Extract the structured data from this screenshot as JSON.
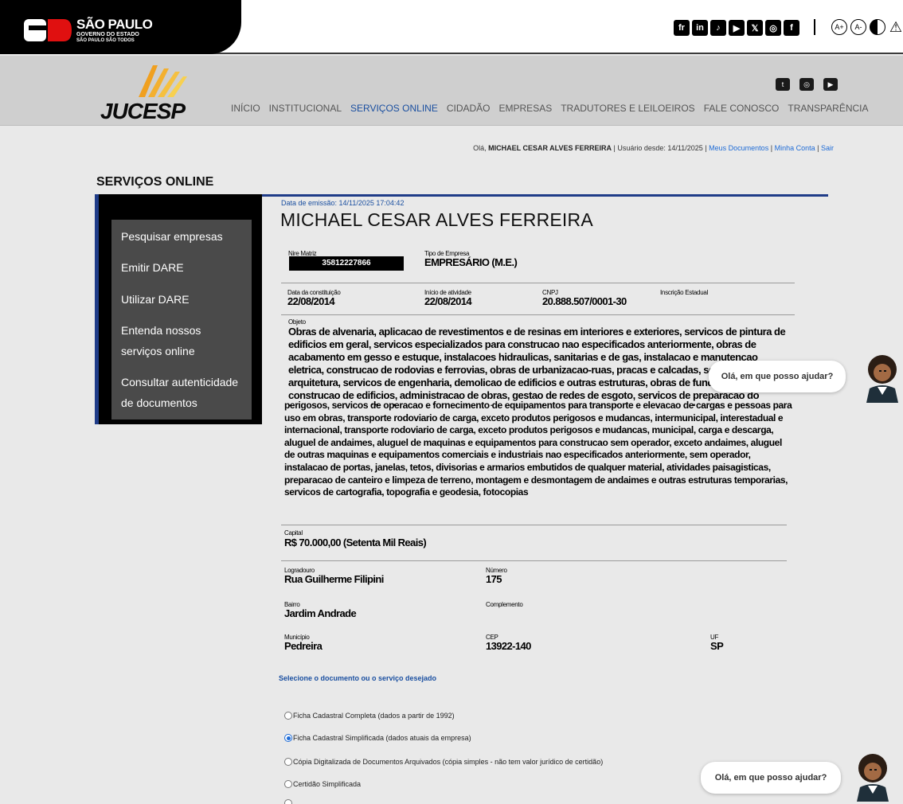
{
  "gov": {
    "title": "SÃO PAULO",
    "subtitle": "GOVERNO DO ESTADO",
    "slogan": "SÃO PAULO SÃO TODOS",
    "social": [
      "fr",
      "in",
      "♪",
      "▶",
      "𝕏",
      "◎",
      "f"
    ],
    "accessibility": [
      "A+",
      "A-"
    ]
  },
  "jucesp": {
    "logo_text": "JUCESP",
    "nav": [
      "INÍCIO",
      "INSTITUCIONAL",
      "SERVIÇOS ONLINE",
      "CIDADÃO",
      "EMPRESAS",
      "TRADUTORES E LEILOEIROS",
      "FALE CONOSCO",
      "TRANSPARÊNCIA"
    ]
  },
  "user": {
    "greeting": "Olá,",
    "name": "MICHAEL CESAR ALVES FERREIRA",
    "since": "| Usuário desde: 14/11/2025 |",
    "my_docs": "Meus Documentos",
    "sep": "|",
    "my_account": "Minha Conta",
    "sep2": "|",
    "logout": "Sair"
  },
  "section_title": "SERVIÇOS ONLINE",
  "menu": [
    "Pesquisar empresas",
    "Emitir DARE",
    "Utilizar DARE",
    "Entenda nossos serviços online",
    "Consultar autenticidade de documentos"
  ],
  "record": {
    "emission": "Data de emissão: 14/11/2025 17:04:42",
    "company_name": "MICHAEL CESAR ALVES FERREIRA",
    "nire_label": "Nire Matriz",
    "nire": "35812227866",
    "tipo_label": "Tipo de Empresa",
    "tipo": "EMPRESÁRIO (M.E.)",
    "constituicao_label": "Data da constituição",
    "constituicao": "22/08/2014",
    "inicio_label": "Início de atividade",
    "inicio": "22/08/2014",
    "cnpj_label": "CNPJ",
    "cnpj": "20.888.507/0001-30",
    "ie_label": "Inscrição Estadual",
    "objeto_label": "Objeto",
    "objeto_part1": "Obras de alvenaria, aplicacao de revestimentos e de resinas em interiores e exteriores, servicos de pintura de edificios em geral, servicos especializados para construcao nao especificados anteriormente, obras de acabamento em gesso e estuque, instalacoes hidraulicas, sanitarias e de gas, instalacao e manutencao eletrica, construcao de rodovias e ferrovias, obras de urbanizacao-ruas, pracas e calcadas, servicos de arquitetura, servicos de engenharia, demolicao de edificios e outras estruturas, obras de fundacoes, construcao de edificios, administracao de obras, gestao de redes de esgoto, servicos de preparacao do terreno nao especificados anteriormente, outras obras de acabamento da construcao, coleta de residuos nao",
    "objeto_part2": "perigosos, servicos de operacao e fornecimento de equipamentos para transporte e elevacao de cargas e pessoas para uso em obras, transporte rodoviario de carga, exceto produtos perigosos e mudancas, intermunicipal, interestadual e internacional, transporte rodoviario de carga, exceto produtos perigosos e mudancas, municipal, carga e descarga, aluguel de andaimes, aluguel de maquinas e equipamentos para construcao sem operador, exceto andaimes, aluguel de outras maquinas e equipamentos comerciais e industriais nao especificados anteriormente, sem operador, instalacao de portas, janelas, tetos, divisorias e armarios embutidos de qualquer material, atividades paisagisticas, preparacao de canteiro e limpeza de terreno, montagem e desmontagem de andaimes e outras estruturas temporarias, servicos de cartografia, topografia e geodesia, fotocopias",
    "capital_label": "Capital",
    "capital": "R$ 70.000,00 (Setenta Mil Reais)",
    "logradouro_label": "Logradouro",
    "logradouro": "Rua Guilherme Filipini",
    "numero_label": "Número",
    "numero": "175",
    "bairro_label": "Bairro",
    "bairro": "Jardim Andrade",
    "complemento_label": "Complemento",
    "municipio_label": "Município",
    "municipio": "Pedreira",
    "cep_label": "CEP",
    "cep": "13922-140",
    "uf_label": "UF",
    "uf": "SP"
  },
  "select_title": "Selecione o documento ou o serviço desejado",
  "options": [
    {
      "label": "Ficha Cadastral Completa (dados a partir de 1992)",
      "checked": false
    },
    {
      "label": "Ficha Cadastral Simplificada (dados atuais da empresa)",
      "checked": true
    },
    {
      "label": "Cópia Digitalizada de Documentos Arquivados (cópia simples - não tem valor jurídico de certidão)",
      "checked": false
    },
    {
      "label": "Certidão Simplificada",
      "checked": false
    }
  ],
  "chat": {
    "bubble": "Olá, em que posso ajudar?"
  },
  "colors": {
    "accent": "#1f3c88",
    "link": "#1e6bd6",
    "jucesp_orange": "#f0a020"
  }
}
